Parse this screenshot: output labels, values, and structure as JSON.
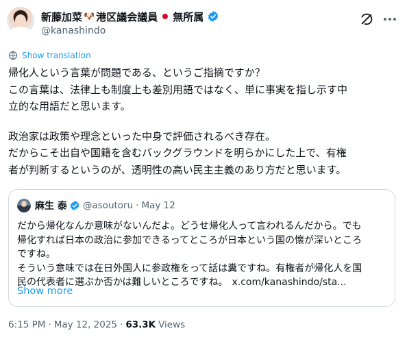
{
  "author": {
    "name": "新藤加菜",
    "name_emoji": "🐶",
    "title_role": "港区議会議員",
    "affiliation": "無所属",
    "handle": "@kanashindo"
  },
  "translate_label": "Show translation",
  "tweet_lines": [
    "帰化人という言葉が問題である、というご指摘ですか？",
    "この言葉は、法律上も制度上も差別用語ではなく、単に事実を指し示す中",
    "立的な用語だと思います。",
    "政治家は政策や理念といった中身で評価されるべき存在。",
    "だからこそ出自や国籍を含むバックグラウンドを明らかにした上で、有権",
    "者が判断するというのが、透明性の高い民主主義のあり方だと思います。"
  ],
  "quote": {
    "name": "麻生 泰",
    "handle": "@asoutoru",
    "separator": "·",
    "date": "May 12",
    "lines": [
      "だから帰化なんか意味がないんだよ。どうせ帰化人って言われるんだから。でも",
      "帰化すれば日本の政治に参加できるってところが日本という国の懐が深いところ",
      "ですね。",
      "そういう意味では在日外国人に参政権をって話は糞ですね。有権者が帰化人を国",
      "民の代表者に選ぶか否かは難しいところですね。"
    ],
    "link_text": "x.com/kanashindo/sta...",
    "show_more": "Show more"
  },
  "meta": {
    "time": "6:15 PM",
    "separator": "·",
    "date": "May 12, 2025",
    "views_count": "63.3K",
    "views_label": "Views"
  },
  "colors": {
    "accent": "#1d9bf0",
    "text": "#0f1419",
    "muted": "#536471",
    "border": "#cfd9de"
  }
}
